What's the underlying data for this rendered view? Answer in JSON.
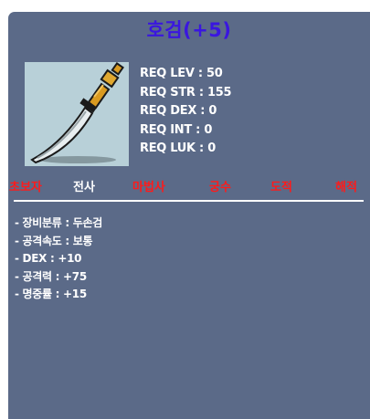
{
  "item": {
    "name": "호검(+5)",
    "icon": "two-handed-sword-icon"
  },
  "requirements": [
    {
      "label": "REQ LEV",
      "value": "50"
    },
    {
      "label": "REQ STR",
      "value": "155"
    },
    {
      "label": "REQ DEX",
      "value": "0"
    },
    {
      "label": "REQ INT",
      "value": "0"
    },
    {
      "label": "REQ LUK",
      "value": "0"
    }
  ],
  "jobs": [
    {
      "name": "초보자",
      "allowed": false
    },
    {
      "name": "전사",
      "allowed": true
    },
    {
      "name": "마법사",
      "allowed": false
    },
    {
      "name": "궁수",
      "allowed": false
    },
    {
      "name": "도적",
      "allowed": false
    },
    {
      "name": "해적",
      "allowed": false
    }
  ],
  "stats": [
    "- 장비분류 : 두손검",
    "- 공격속도 : 보통",
    "- DEX : +10",
    "- 공격력 : +75",
    "- 명중률 : +15"
  ],
  "colors": {
    "background": "#5b6a88",
    "title": "#3a16e0",
    "job_allowed": "#ffffff",
    "job_disallowed": "#ff1a1a"
  }
}
